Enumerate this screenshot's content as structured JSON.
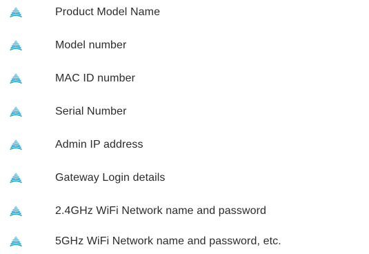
{
  "bullet_icon": "wifi-signal-icon",
  "colors": {
    "bullet_light": "#7fd6f2",
    "bullet_dark": "#1fa6cf",
    "text": "#2b2b2b"
  },
  "items": [
    {
      "label": "Product Model Name"
    },
    {
      "label": "Model number"
    },
    {
      "label": "MAC ID number"
    },
    {
      "label": "Serial Number"
    },
    {
      "label": "Admin IP address"
    },
    {
      "label": "Gateway Login details"
    },
    {
      "label": "2.4GHz WiFi Network name and password"
    },
    {
      "label": "5GHz WiFi Network name and password, etc."
    }
  ]
}
